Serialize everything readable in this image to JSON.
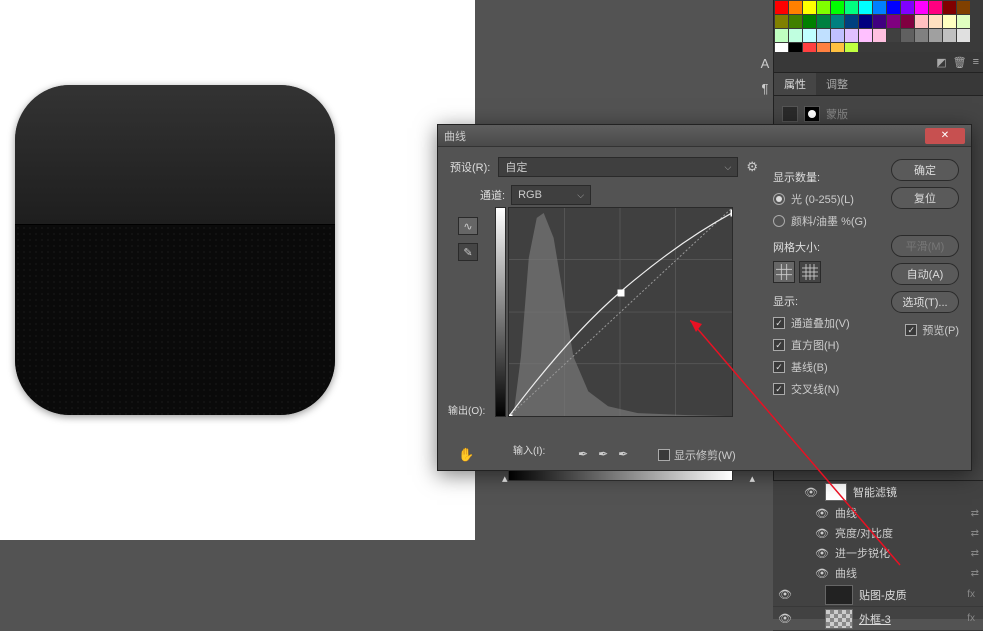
{
  "dialog": {
    "title": "曲线",
    "preset_label": "预设(R):",
    "preset_value": "自定",
    "channel_label": "通道:",
    "channel_value": "RGB",
    "output_label": "输出(O):",
    "input_label": "输入(I):",
    "show_clipping": "显示修剪(W)",
    "amount_title": "显示数量:",
    "radio_light": "光 (0-255)(L)",
    "radio_pigment": "颜料/油墨 %(G)",
    "grid_title": "网格大小:",
    "show_title": "显示:",
    "chk_overlay": "通道叠加(V)",
    "chk_histo": "直方图(H)",
    "chk_baseline": "基线(B)",
    "chk_intersect": "交叉线(N)",
    "btn_ok": "确定",
    "btn_cancel": "复位",
    "btn_smooth": "平滑(M)",
    "btn_auto": "自动(A)",
    "btn_options": "选项(T)...",
    "chk_preview": "预览(P)"
  },
  "panels": {
    "tab_props": "属性",
    "tab_adjust": "调整",
    "prop_label": "蒙版",
    "swatch_colors": [
      "#ff0000",
      "#ff8000",
      "#ffff00",
      "#80ff00",
      "#00ff00",
      "#00ff80",
      "#00ffff",
      "#0080ff",
      "#0000ff",
      "#8000ff",
      "#ff00ff",
      "#ff0080",
      "#800000",
      "#804000",
      "#808000",
      "#408000",
      "#008000",
      "#008040",
      "#008080",
      "#004080",
      "#000080",
      "#400080",
      "#800080",
      "#800040",
      "#ffc0c0",
      "#ffe0c0",
      "#ffffc0",
      "#e0ffc0",
      "#c0ffc0",
      "#c0ffe0",
      "#c0ffff",
      "#c0e0ff",
      "#c0c0ff",
      "#e0c0ff",
      "#ffc0ff",
      "#ffc0e0",
      "#404040",
      "#606060",
      "#808080",
      "#a0a0a0",
      "#c0c0c0",
      "#e0e0e0",
      "#ffffff",
      "#000000",
      "#ff4040",
      "#ff8040",
      "#ffc040",
      "#c0ff40"
    ]
  },
  "layers": {
    "smart_filters": "智能滤镜",
    "items": [
      "曲线",
      "亮度/对比度",
      "进一步锐化",
      "曲线"
    ],
    "layer1": "贴图-皮质",
    "layer2": "外框-3"
  }
}
